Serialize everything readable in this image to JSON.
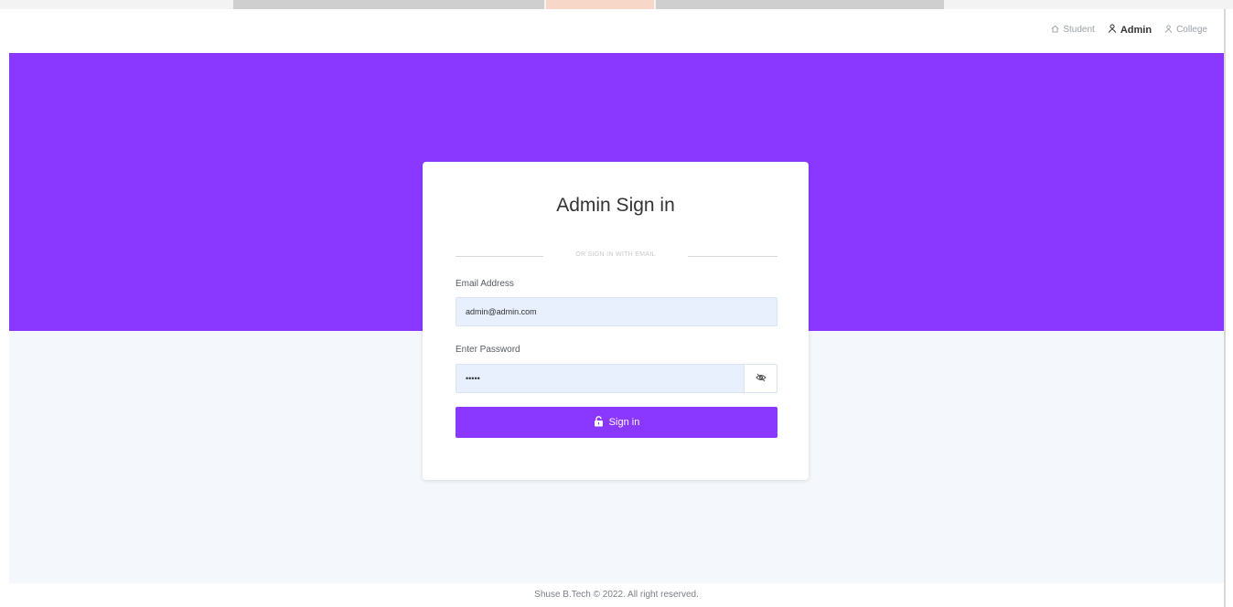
{
  "nav": {
    "student_label": "Student",
    "admin_label": "Admin",
    "college_label": "College"
  },
  "login": {
    "title": "Admin Sign in",
    "divider_text": "OR SIGN IN WITH EMAIL",
    "email_label": "Email Address",
    "email_value": "admin@admin.com",
    "password_label": "Enter Password",
    "password_value": "•••••",
    "signin_label": "Sign in"
  },
  "footer": {
    "text": "Shuse B.Tech © 2022. All right reserved."
  },
  "colors": {
    "brand": "#8a38ff",
    "lower_bg": "#f4f7fc",
    "input_bg": "#e8f0fe"
  },
  "icons": {
    "student": "home-icon",
    "admin": "user-icon",
    "college": "user-icon",
    "password_toggle": "eye-off-icon",
    "signin": "lock-icon"
  }
}
